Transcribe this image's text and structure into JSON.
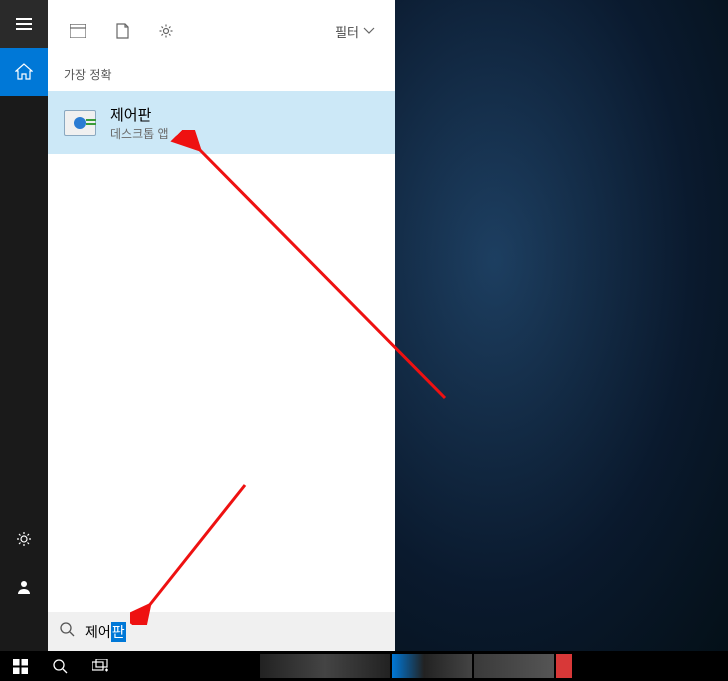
{
  "sidebar": {
    "items": {
      "hamburger": "menu",
      "home": "home",
      "settings": "settings",
      "account": "account"
    }
  },
  "panel": {
    "header": {
      "apps_icon": "apps",
      "docs_icon": "documents",
      "settings_icon": "settings",
      "filter_label": "필터"
    },
    "section_header": "가장 정확",
    "result": {
      "title": "제어판",
      "subtitle": "데스크톱 앱"
    },
    "search": {
      "typed_text": "제어",
      "completion_text": "판"
    }
  },
  "taskbar": {
    "start": "Start",
    "search": "Search",
    "taskview": "Task View"
  }
}
